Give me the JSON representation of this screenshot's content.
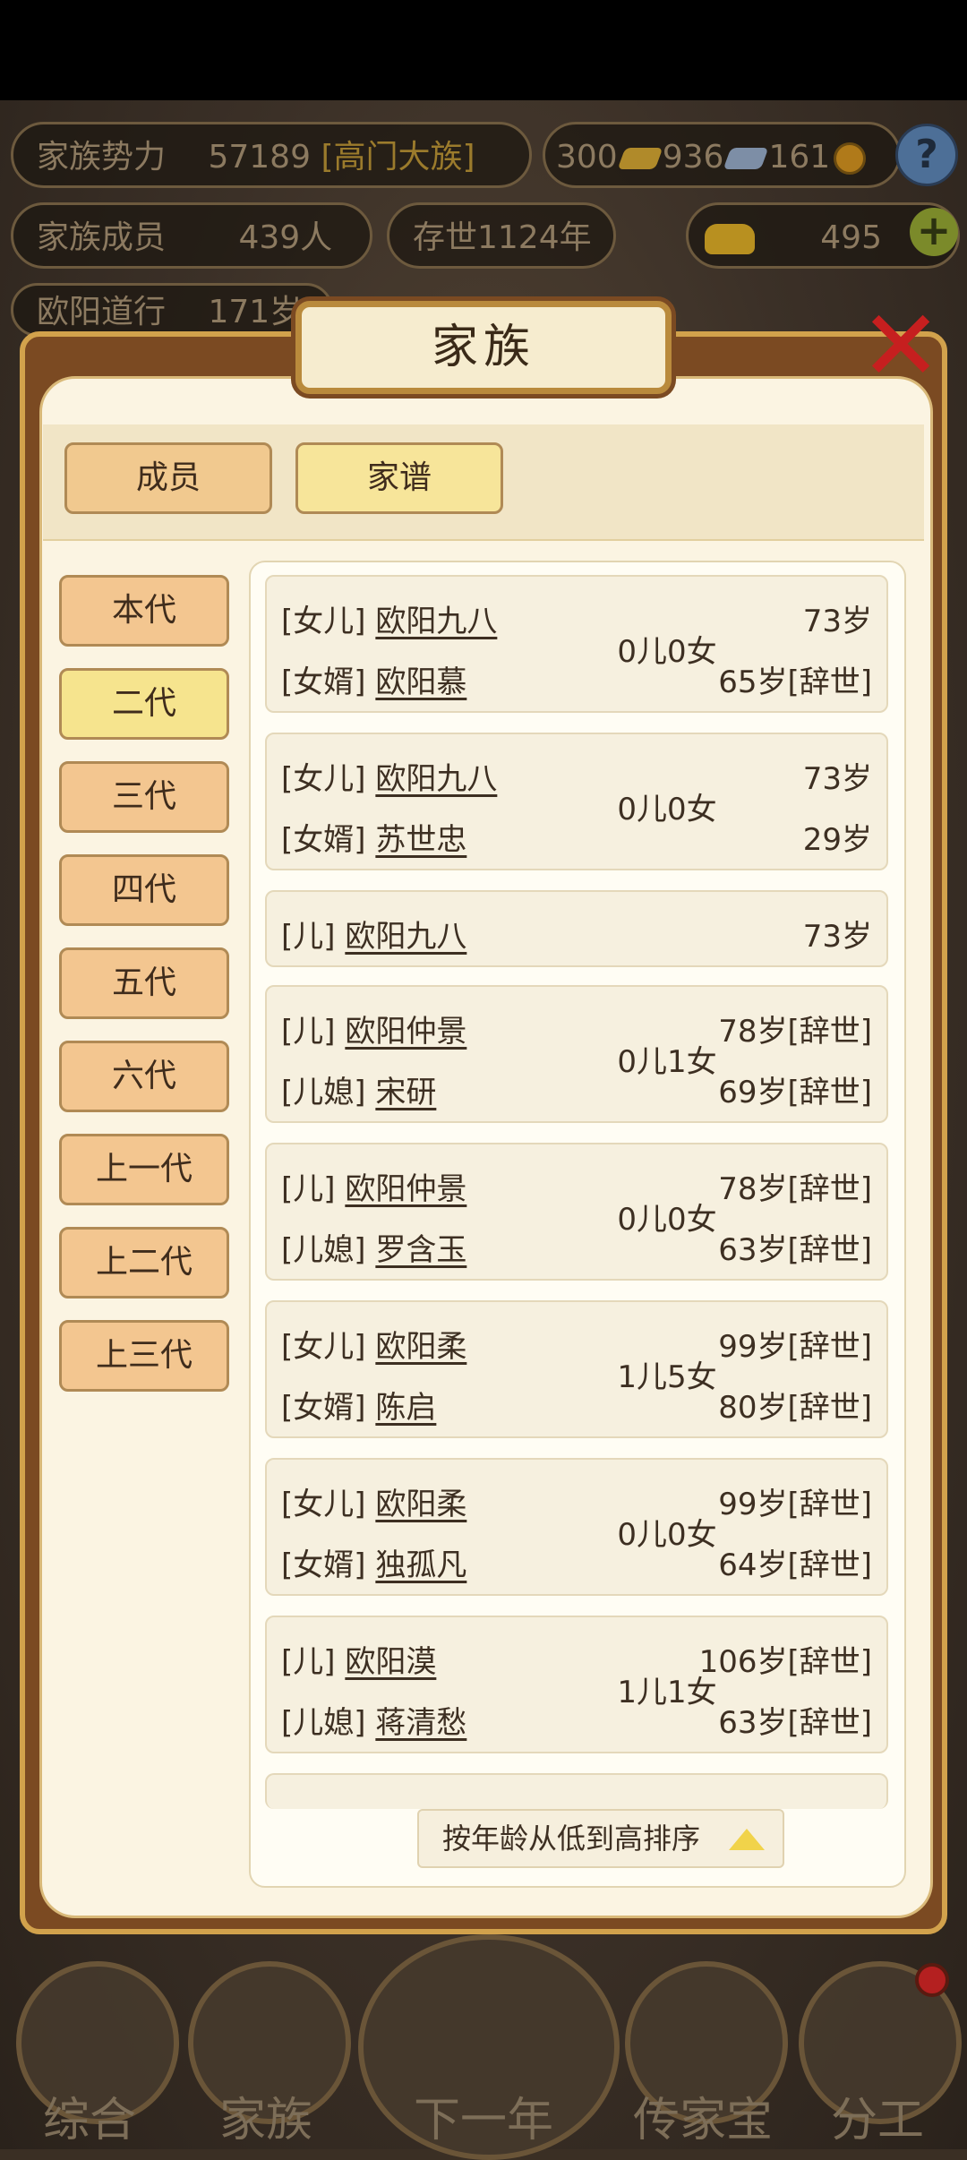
{
  "hud": {
    "power_label": "家族势力",
    "power_value": "57189",
    "power_rank": "[高门大族]",
    "res1": "300",
    "res2": "936",
    "res3": "161",
    "members_label": "家族成员",
    "members_value": "439人",
    "existence": "存世1124年",
    "gold": "495",
    "partial_name": "欧阳道行",
    "partial_age": "171岁"
  },
  "dialog": {
    "title": "家族",
    "tabs": [
      {
        "label": "成员"
      },
      {
        "label": "家谱"
      }
    ],
    "generations": [
      {
        "label": "本代"
      },
      {
        "label": "二代"
      },
      {
        "label": "三代"
      },
      {
        "label": "四代"
      },
      {
        "label": "五代"
      },
      {
        "label": "六代"
      },
      {
        "label": "上一代"
      },
      {
        "label": "上二代"
      },
      {
        "label": "上三代"
      }
    ],
    "records": [
      {
        "p1_rel": "[女儿]",
        "p1_name": "欧阳九八",
        "p1_age": "73岁",
        "p2_rel": "[女婿]",
        "p2_name": "欧阳慕",
        "p2_age": "65岁[辞世]",
        "children": "0儿0女"
      },
      {
        "p1_rel": "[女儿]",
        "p1_name": "欧阳九八",
        "p1_age": "73岁",
        "p2_rel": "[女婿]",
        "p2_name": "苏世忠",
        "p2_age": "29岁",
        "children": "0儿0女"
      },
      {
        "p1_rel": "[儿]",
        "p1_name": "欧阳九八",
        "p1_age": "73岁"
      },
      {
        "p1_rel": "[儿]",
        "p1_name": "欧阳仲景",
        "p1_age": "78岁[辞世]",
        "p2_rel": "[儿媳]",
        "p2_name": "宋研",
        "p2_age": "69岁[辞世]",
        "children": "0儿1女"
      },
      {
        "p1_rel": "[儿]",
        "p1_name": "欧阳仲景",
        "p1_age": "78岁[辞世]",
        "p2_rel": "[儿媳]",
        "p2_name": "罗含玉",
        "p2_age": "63岁[辞世]",
        "children": "0儿0女"
      },
      {
        "p1_rel": "[女儿]",
        "p1_name": "欧阳柔",
        "p1_age": "99岁[辞世]",
        "p2_rel": "[女婿]",
        "p2_name": "陈启",
        "p2_age": "80岁[辞世]",
        "children": "1儿5女"
      },
      {
        "p1_rel": "[女儿]",
        "p1_name": "欧阳柔",
        "p1_age": "99岁[辞世]",
        "p2_rel": "[女婿]",
        "p2_name": "独孤凡",
        "p2_age": "64岁[辞世]",
        "children": "0儿0女"
      },
      {
        "p1_rel": "[儿]",
        "p1_name": "欧阳漠",
        "p1_age": "106岁[辞世]",
        "p2_rel": "[儿媳]",
        "p2_name": "蒋清愁",
        "p2_age": "63岁[辞世]",
        "children": "1儿1女"
      }
    ],
    "sort_label": "按年龄从低到高排序"
  },
  "nav": [
    {
      "label": "综合"
    },
    {
      "label": "家族"
    },
    {
      "label": "下一年"
    },
    {
      "label": "传家宝"
    },
    {
      "label": "分工"
    }
  ]
}
